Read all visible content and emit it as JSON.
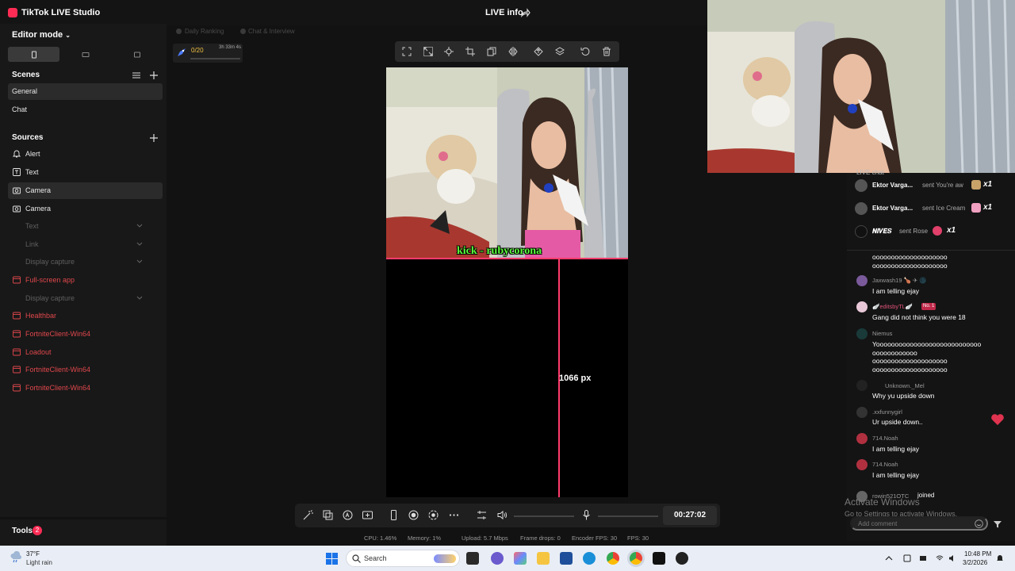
{
  "app": {
    "title": "TikTok LIVE Studio",
    "live_info": "LIVE info"
  },
  "sidebar": {
    "editor_mode": "Editor mode",
    "scenes_title": "Scenes",
    "scenes": [
      {
        "label": "General",
        "active": true
      },
      {
        "label": "Chat",
        "active": false
      }
    ],
    "sources_title": "Sources",
    "sources": [
      {
        "label": "Alert",
        "state": "white",
        "icon": "bell-icon"
      },
      {
        "label": "Text",
        "state": "white",
        "icon": "text-icon"
      },
      {
        "label": "Camera",
        "state": "white",
        "icon": "camera-icon",
        "active": true
      },
      {
        "label": "Camera",
        "state": "white",
        "icon": "camera-icon"
      },
      {
        "label": "Text",
        "state": "dim",
        "chevron": true
      },
      {
        "label": "Link",
        "state": "dim",
        "chevron": true
      },
      {
        "label": "Display capture",
        "state": "dim",
        "chevron": true
      },
      {
        "label": "Full-screen app",
        "state": "red"
      },
      {
        "label": "Display capture",
        "state": "dim",
        "chevron": true
      },
      {
        "label": "Healthbar",
        "state": "red"
      },
      {
        "label": "FortniteClient-Win64",
        "state": "red"
      },
      {
        "label": "Loadout",
        "state": "red"
      },
      {
        "label": "FortniteClient-Win64",
        "state": "red"
      },
      {
        "label": "FortniteClient-Win64",
        "state": "red"
      }
    ],
    "tools_label": "Tools",
    "tools_badge": "2"
  },
  "ranking": {
    "tab_daily": "Daily Ranking",
    "tab_chat": "Chat & Interview",
    "count": "0/20",
    "time": "3h 33m 4s"
  },
  "canvas": {
    "overlay_text": "kick - rubycorona",
    "measure_label": "1066 px"
  },
  "controls": {
    "timer": "00:27:02",
    "volume_level": 0,
    "mic_level": 0
  },
  "stats": {
    "cpu": "CPU:  1.46%",
    "memory": "Memory:  1%",
    "upload": "Upload:  5.7 Mbps",
    "frame_drops": "Frame drops:  0",
    "encoder_fps": "Encoder FPS:  30",
    "fps": "FPS:  30"
  },
  "chat": {
    "title": "LIVE chat",
    "gifts": [
      {
        "name": "Ektor Varga...",
        "text": "sent You're aw",
        "count": "x1",
        "icon_color": "#c9a26a"
      },
      {
        "name": "Ektor Varga...",
        "text": "sent Ice Cream",
        "count": "x1",
        "icon_color": "#f0a0c0"
      },
      {
        "name": "𝑵𝑰𝑽𝑬𝑺",
        "text": "sent Rose",
        "count": "x1",
        "icon_color": "#e0406a"
      }
    ],
    "messages": [
      {
        "user": "",
        "text": "oooooooooooooooooooo\noooooooooooooooooooo",
        "avatar": ""
      },
      {
        "user": "Jaxwash19 🍗 ✈ 🌑",
        "text": "I am telling ejay",
        "avatar": "#7a5a9a"
      },
      {
        "user": "🪽editsbyTL🪽",
        "badge": "No. 1",
        "text": "Gang did not think you were 18",
        "avatar": "#e8c8d8"
      },
      {
        "user": "Niemus",
        "text": "Yoooooooooooooooooooooooooooo\noooooooooooo\noooooooooooooooooooo\noooooooooooooooooooo",
        "avatar": "#1a3a3a"
      },
      {
        "user": "Unknown._Mel",
        "text": "Why yu upside down",
        "avatar": "#222"
      },
      {
        "user": ".xxfunnygirl",
        "text": "Ur upside down..",
        "avatar": "#333"
      },
      {
        "user": "714.Noah",
        "text": "I am telling ejay",
        "avatar": "#b03040"
      },
      {
        "user": "714.Noah",
        "text": "I am telling ejay",
        "avatar": "#b03040"
      }
    ],
    "join_user": "rowin521OTC",
    "join_text": "joined",
    "comment_placeholder": "Add comment"
  },
  "watermark": {
    "title": "Activate Windows",
    "subtitle": "Go to Settings to activate Windows."
  },
  "taskbar": {
    "temp": "37°F",
    "weather": "Light rain",
    "search": "Search",
    "time": "10:48 PM",
    "date": "3/2/2026"
  }
}
